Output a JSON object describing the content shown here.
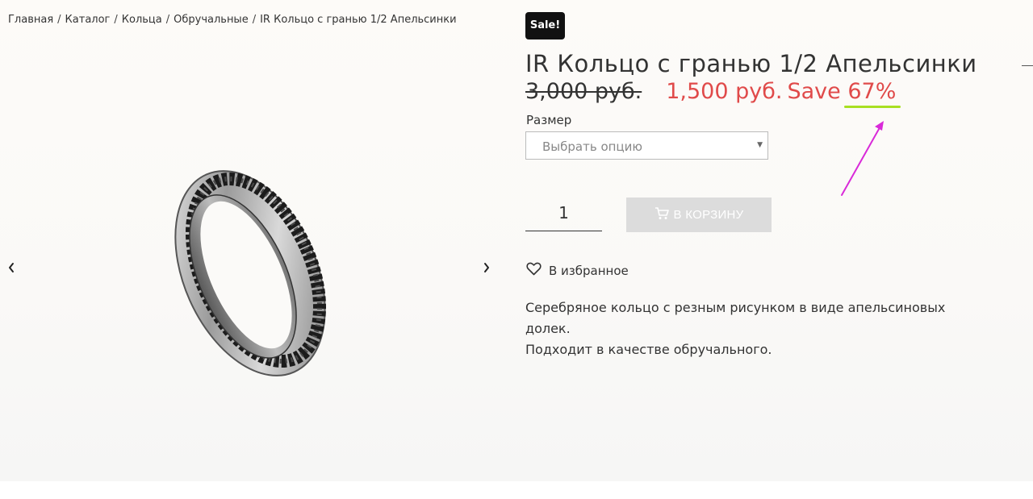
{
  "breadcrumb": {
    "items": [
      "Главная",
      "Каталог",
      "Кольца",
      "Обручальные",
      "IR Кольцо с гранью 1/2 Апельсинки"
    ],
    "separator": "/"
  },
  "product": {
    "badge": "Sale!",
    "title": "IR Кольцо с гранью 1/2 Апельсинки",
    "old_price": "3,000 руб.",
    "new_price": "1,500 руб.",
    "save_label": "Save",
    "save_percent": "67%",
    "size_label": "Размер",
    "size_placeholder": "Выбрать опцию",
    "quantity": "1",
    "add_to_cart_label": "В КОРЗИНУ",
    "wishlist_label": "В избранное",
    "description": [
      "Серебряное кольцо с резным рисунком в виде апельсиновых",
      "долек.",
      "Подходит в качестве обручального."
    ]
  },
  "gallery": {
    "prev_icon": "chevron-left-icon",
    "next_icon": "chevron-right-icon",
    "image": "silver ring with orange slice engraving"
  },
  "colors": {
    "sale_price": "#e04a4a",
    "badge_bg": "#111111",
    "button_disabled": "#dcdcdc",
    "annotation_arrow": "#d92ad9",
    "annotation_underline": "#a8e022"
  }
}
